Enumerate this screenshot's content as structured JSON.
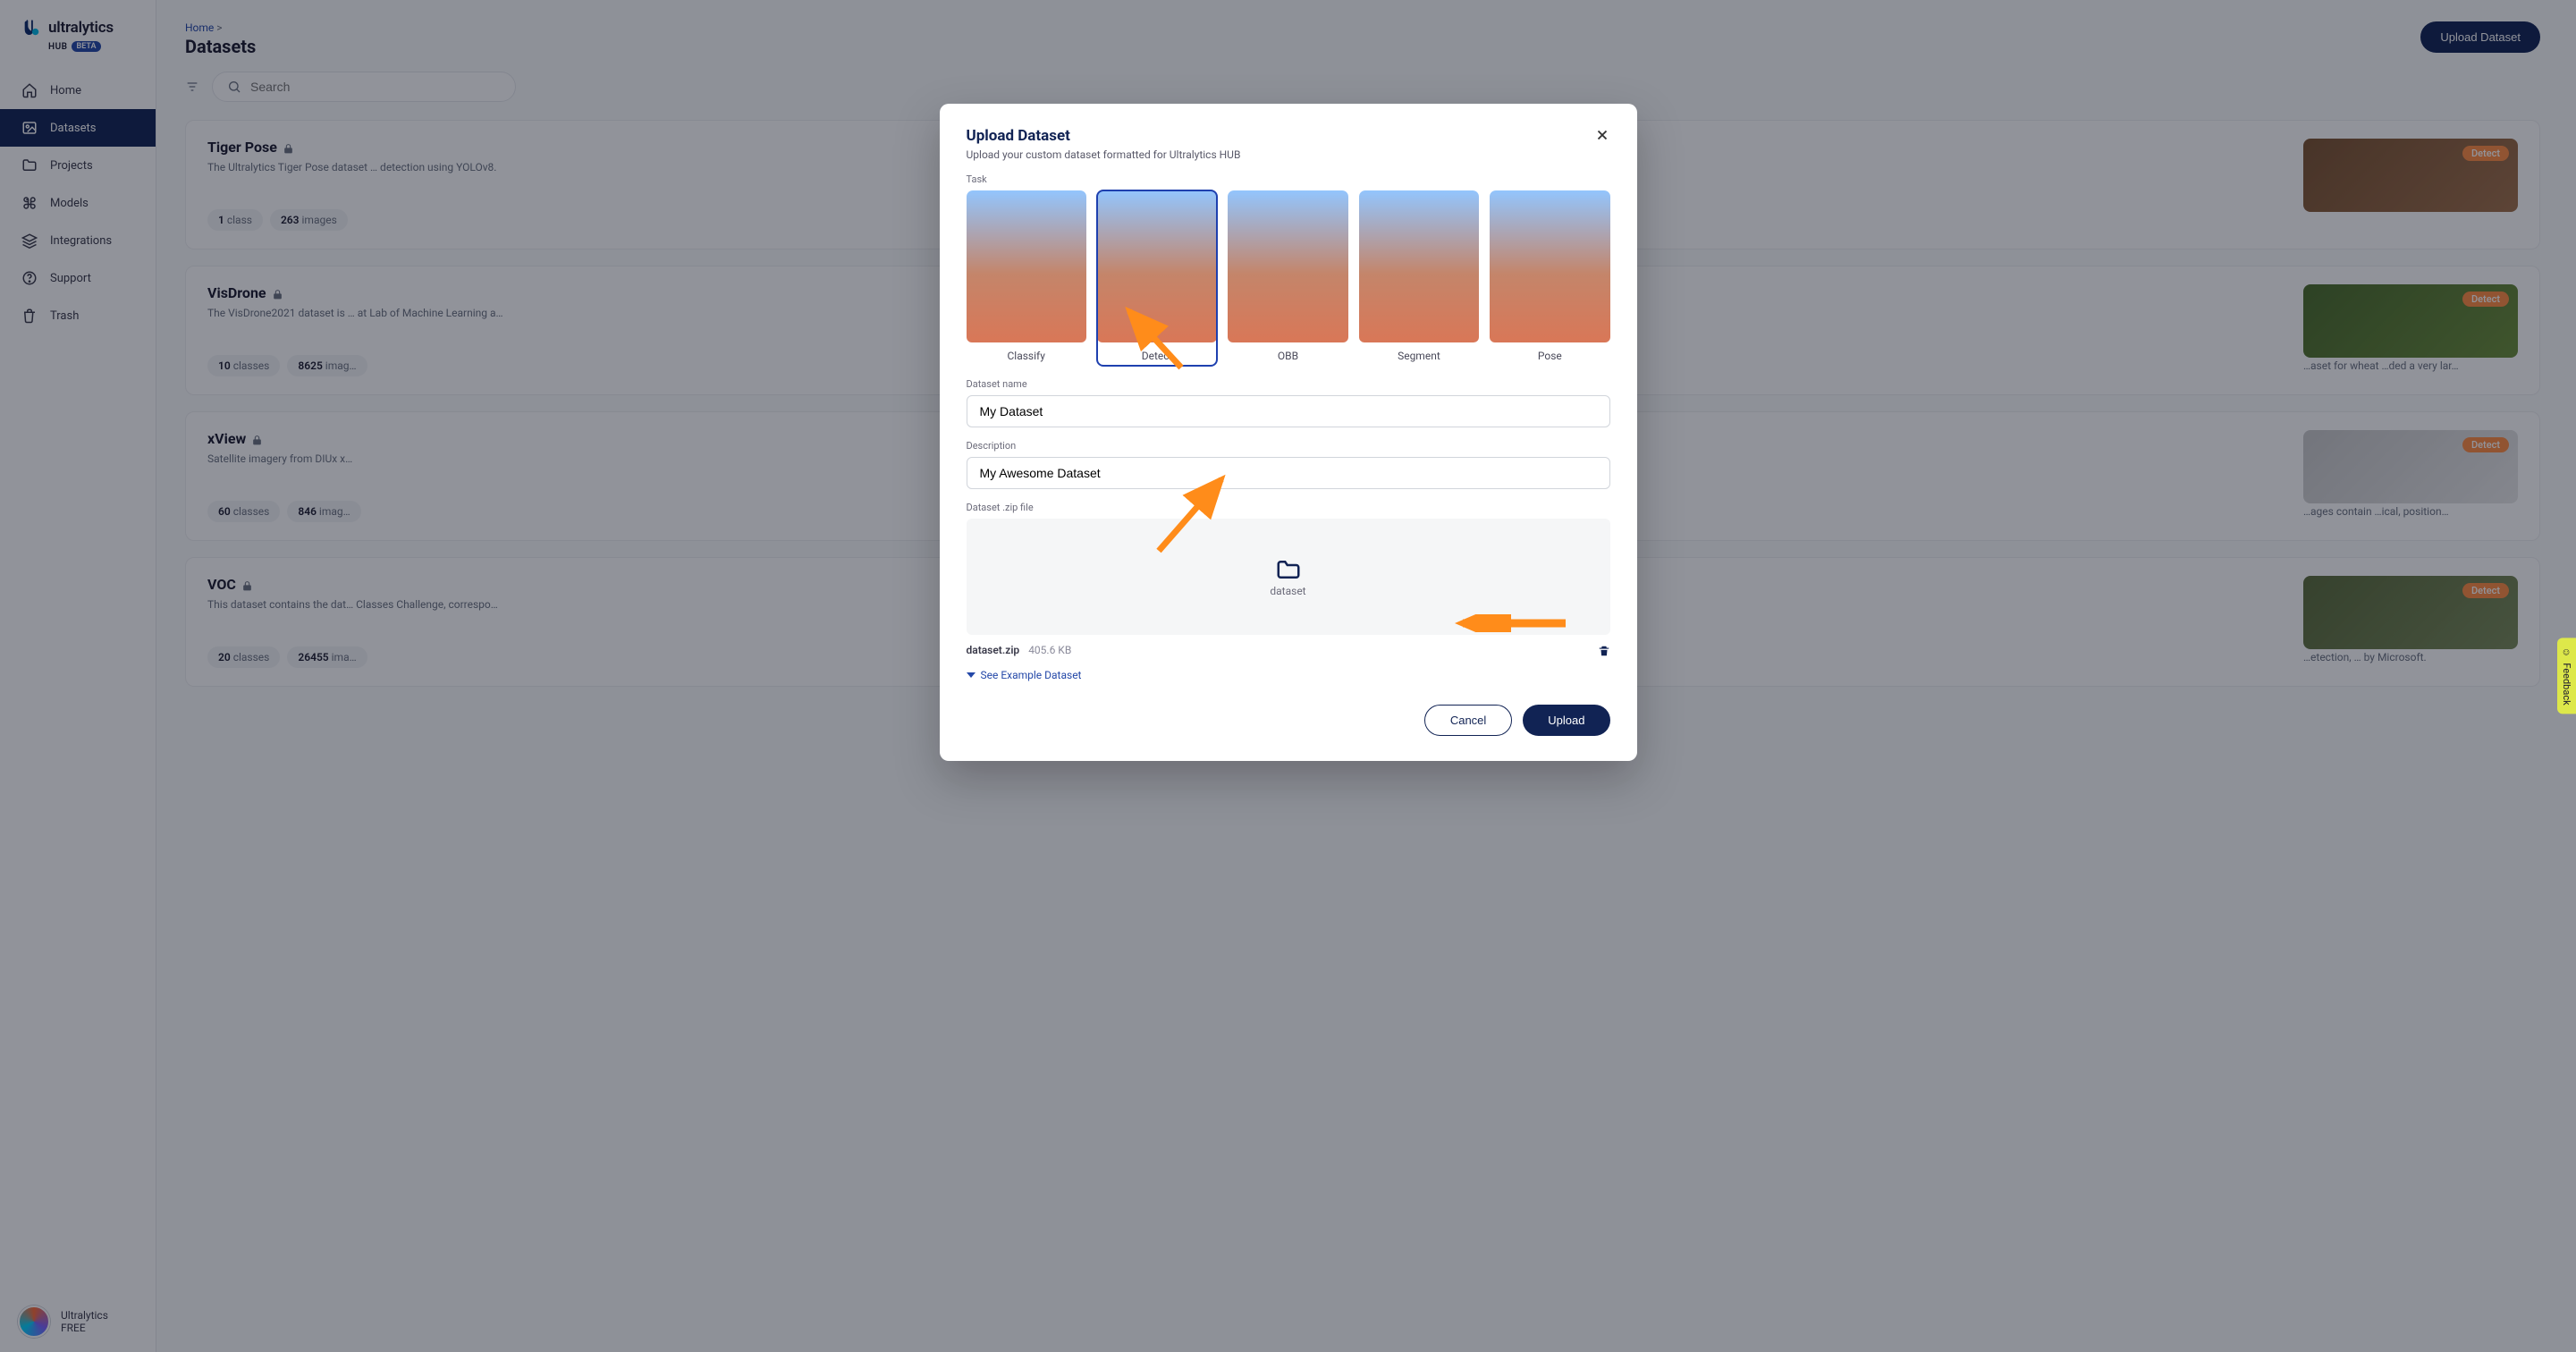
{
  "brand": {
    "name": "ultralytics",
    "sub": "HUB",
    "badge": "BETA"
  },
  "nav": {
    "home": "Home",
    "datasets": "Datasets",
    "projects": "Projects",
    "models": "Models",
    "integrations": "Integrations",
    "support": "Support",
    "trash": "Trash"
  },
  "footer": {
    "name": "Ultralytics",
    "plan": "FREE"
  },
  "breadcrumb": {
    "root": "Home",
    "sep": ">",
    "title": "Datasets"
  },
  "header_btn": "Upload Dataset",
  "search_placeholder": "Search",
  "tag_detect": "Detect",
  "datasets": [
    {
      "title": "Tiger Pose",
      "desc": "The Ultralytics Tiger Pose dataset … detection using YOLOv8.",
      "classes": "1",
      "class_lbl": "class",
      "images": "263",
      "img_lbl": "images"
    },
    {
      "title": "VisDrone",
      "desc": "The VisDrone2021 dataset is … at Lab of Machine Learning a…",
      "classes": "10",
      "class_lbl": "classes",
      "images": "8625",
      "img_lbl": "imag…",
      "side_desc": "…aset for wheat …ded a very lar…"
    },
    {
      "title": "xView",
      "desc": "Satellite imagery from DIUx x…",
      "classes": "60",
      "class_lbl": "classes",
      "images": "846",
      "img_lbl": "imag…",
      "side_desc": "…ages contain …ical, position…"
    },
    {
      "title": "VOC",
      "desc": "This dataset contains the dat… Classes Challenge, correspo…",
      "classes": "20",
      "class_lbl": "classes",
      "images": "26455",
      "img_lbl": "ima…",
      "side_desc": "…etection, … by Microsoft."
    }
  ],
  "modal": {
    "title": "Upload Dataset",
    "subtitle": "Upload your custom dataset formatted for Ultralytics HUB",
    "task_label": "Task",
    "tasks": [
      "Classify",
      "Detect",
      "OBB",
      "Segment",
      "Pose"
    ],
    "selected_task": 1,
    "name_label": "Dataset name",
    "name_value": "My Dataset",
    "desc_label": "Description",
    "desc_value": "My Awesome Dataset",
    "zip_label": "Dataset .zip file",
    "zone_label": "dataset",
    "uploaded_file": "dataset.zip",
    "uploaded_size": "405.6 KB",
    "example": "See Example Dataset",
    "cancel": "Cancel",
    "upload": "Upload"
  },
  "feedback": "Feedback"
}
